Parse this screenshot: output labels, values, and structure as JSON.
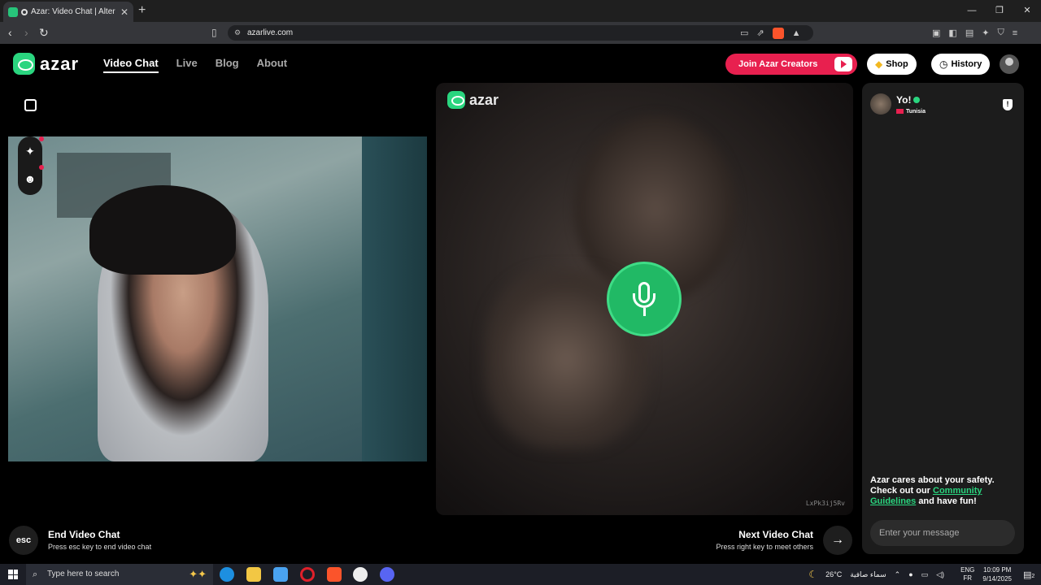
{
  "browser": {
    "tab_title": "Azar: Video Chat | Alternative",
    "url": "azarlive.com"
  },
  "site": {
    "logo_text": "azar",
    "nav": [
      "Video Chat",
      "Live",
      "Blog",
      "About"
    ],
    "join_creators": "Join Azar Creators",
    "shop": "Shop",
    "history": "History"
  },
  "remote": {
    "logo_text": "azar",
    "watermark": "LxPk3ij5Rv"
  },
  "chat": {
    "peer_name": "Yo!",
    "peer_country": "Tunisia",
    "safety_line1": "Azar cares about your safety.",
    "safety_line2": "Check out our",
    "safety_link": "Community Guidelines",
    "safety_line3": "and have fun!",
    "input_placeholder": "Enter your message"
  },
  "controls": {
    "esc_label": "esc",
    "end_title": "End Video Chat",
    "end_sub": "Press esc key to end video chat",
    "next_title": "Next Video Chat",
    "next_sub": "Press right key to meet others"
  },
  "taskbar": {
    "search_placeholder": "Type here to search",
    "temperature": "26°C",
    "weather": "سماء صافية",
    "lang1": "ENG",
    "lang2": "FR",
    "time": "10:09 PM",
    "date": "9/14/2025",
    "notif_count": "2"
  },
  "colors": {
    "brand_green": "#2ad57f",
    "creators_red": "#e8204f",
    "mic_green": "#21b965"
  }
}
